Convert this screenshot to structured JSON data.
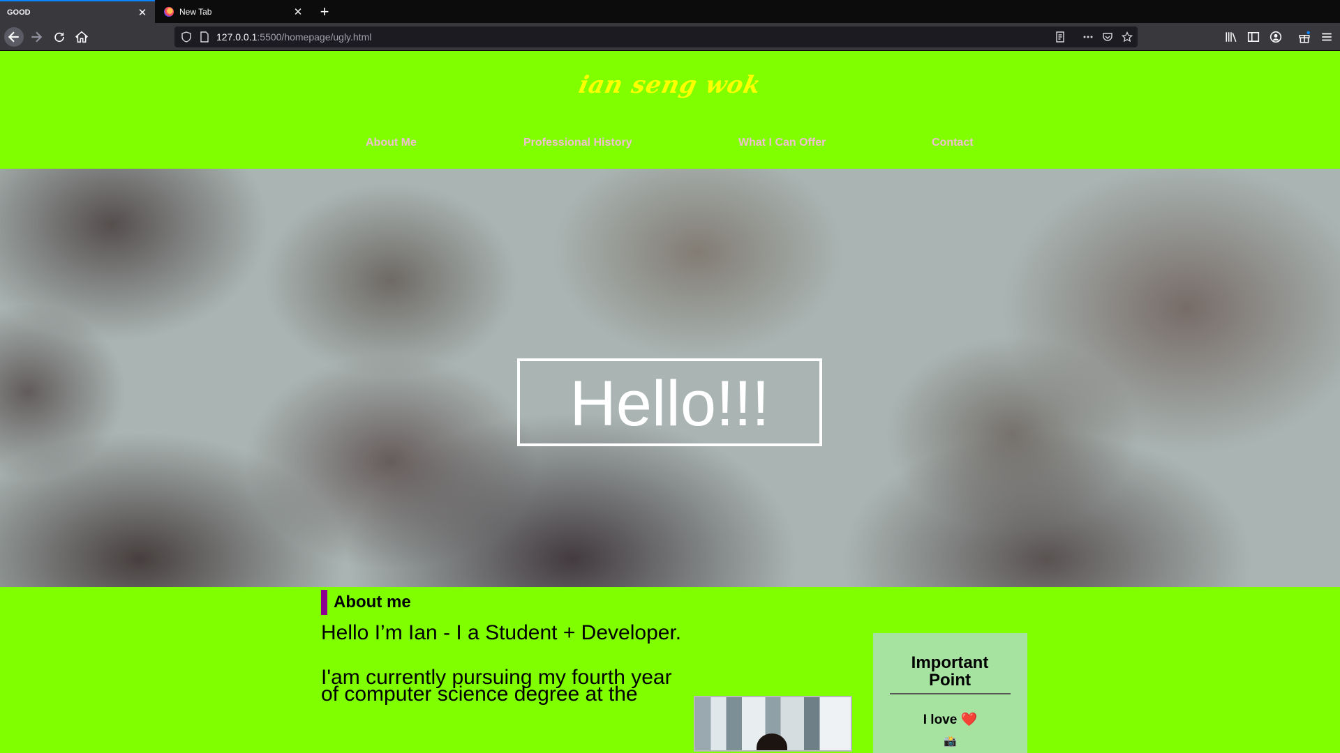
{
  "browser": {
    "tabs": [
      {
        "label": "GOOD",
        "active": true
      },
      {
        "label": "New Tab",
        "active": false
      }
    ],
    "new_tab_symbol": "+",
    "close_symbol": "✕",
    "url_host": "127.0.0.1",
    "url_rest": ":5500/homepage/ugly.html",
    "accent_color": "#0a84ff"
  },
  "site": {
    "title": "ian seng wok",
    "nav": [
      "About Me",
      "Professional History",
      "What I Can Offer",
      "Contact"
    ],
    "background_color": "#7fff00",
    "title_color": "#ffff00"
  },
  "hero": {
    "greeting": "Hello!!!"
  },
  "about": {
    "heading": "About me",
    "paragraph1": "Hello I’m Ian - I a Student + Developer.",
    "paragraph2": "I'am currently pursuing my fourth year of computer science degree at the",
    "accent_color": "#8b0090"
  },
  "side_card": {
    "title": "Important Point",
    "love_text": "I love",
    "heart_symbol": "❤️",
    "camera_symbol": "📸",
    "background_color": "#a6e3a1"
  }
}
